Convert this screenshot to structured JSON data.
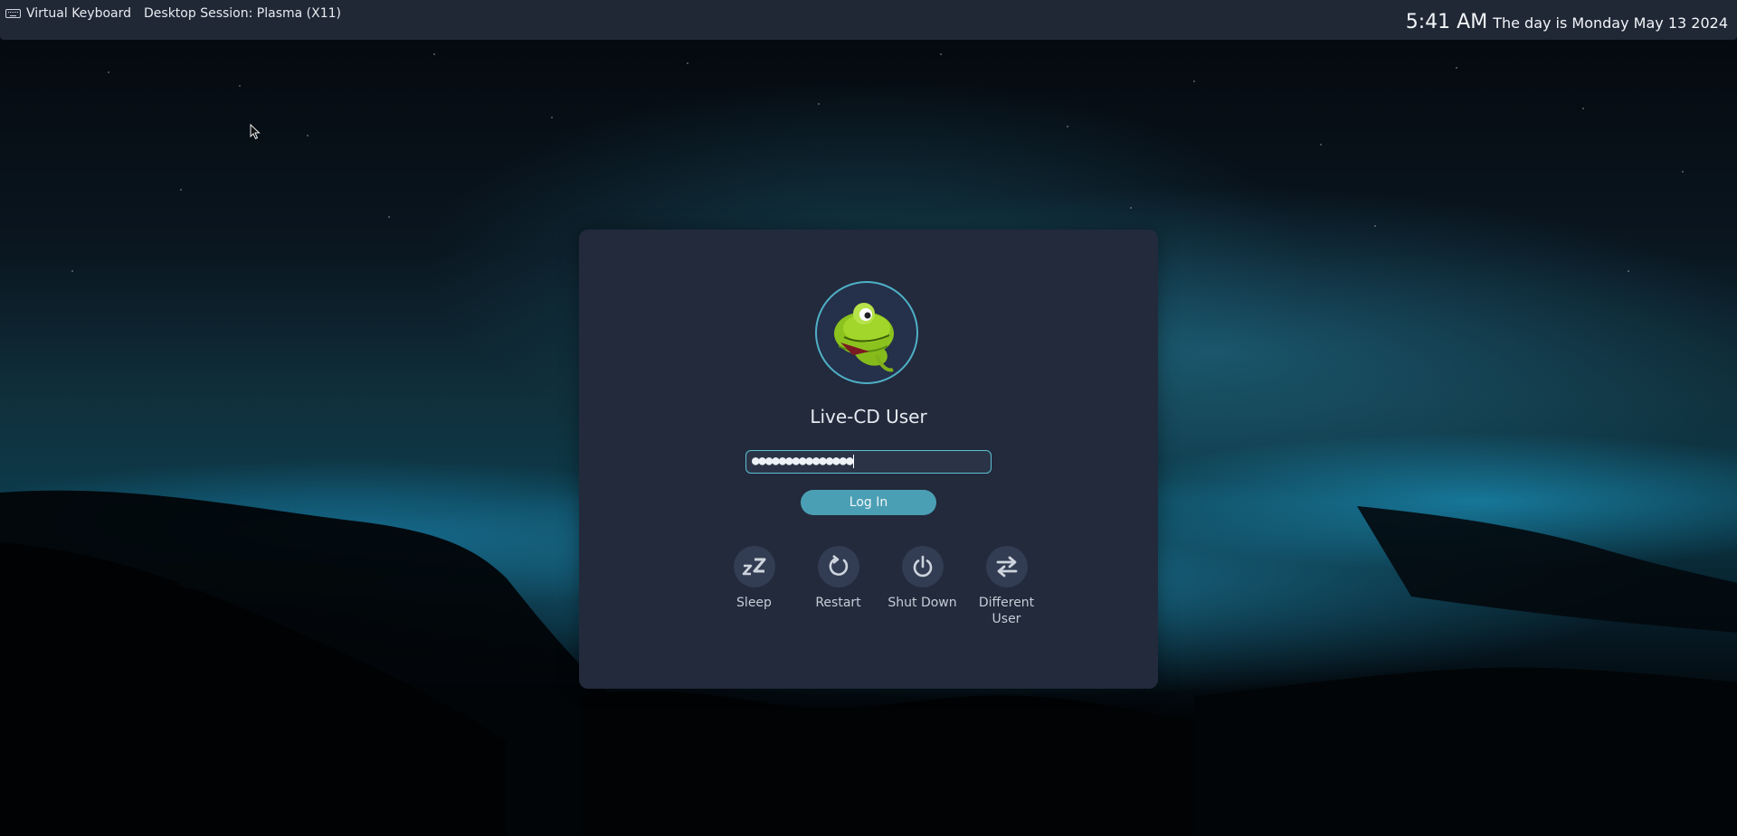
{
  "topbar": {
    "virtual_keyboard_label": "Virtual Keyboard",
    "session_label": "Desktop Session: Plasma (X11)",
    "clock_time": "5:41 AM",
    "clock_date": "The day is Monday May 13 2024"
  },
  "login": {
    "username": "Live-CD User",
    "password_masked": "●●●●●●●●●●●●●●●",
    "login_button": "Log In"
  },
  "actions": [
    {
      "label": "Sleep",
      "icon": "sleep-icon"
    },
    {
      "label": "Restart",
      "icon": "restart-icon"
    },
    {
      "label": "Shut Down",
      "icon": "power-icon"
    },
    {
      "label": "Different User",
      "icon": "switch-user-icon"
    }
  ],
  "colors": {
    "panel_bg": "#222a3c",
    "accent": "#4b9fb4",
    "field_border": "#5cc0d2"
  }
}
